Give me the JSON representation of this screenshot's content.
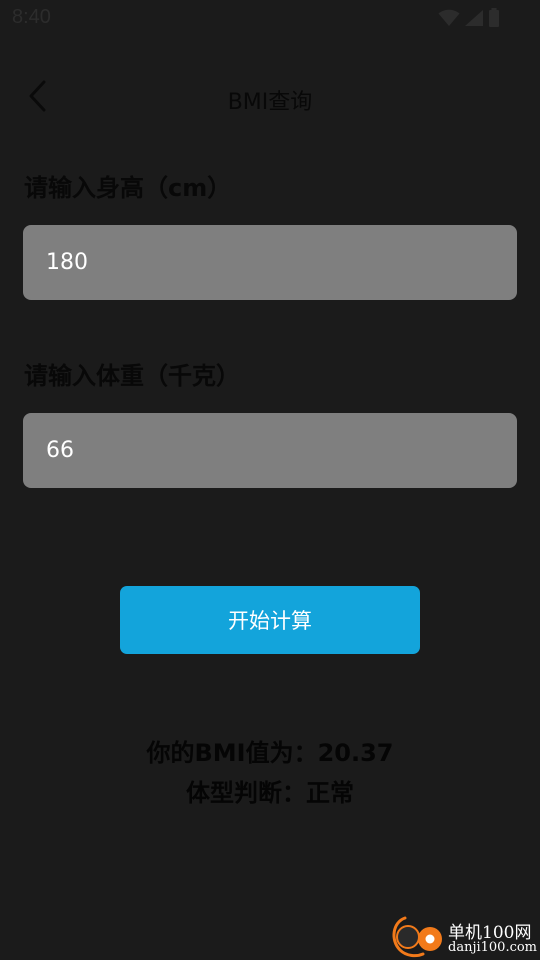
{
  "status_bar": {
    "time": "8:40",
    "icons": [
      "wifi-icon",
      "cellular-signal-icon",
      "battery-icon"
    ]
  },
  "toolbar": {
    "back_icon": "chevron-left-icon",
    "title": "BMI查询"
  },
  "form": {
    "height_label": "请输入身高（cm）",
    "height_value": "180",
    "weight_label": "请输入体重（千克）",
    "weight_value": "66",
    "calculate_label": "开始计算"
  },
  "result": {
    "bmi_text": "你的BMI值为：20.37",
    "type_text": "体型判断：正常"
  },
  "watermark": {
    "name": "单机100网",
    "domain": "danji100.com"
  },
  "colors": {
    "background": "#1b1b1b",
    "input_fill": "#7f7f7f",
    "button_accent": "#13a4db",
    "watermark_orange": "#f27a1a"
  }
}
